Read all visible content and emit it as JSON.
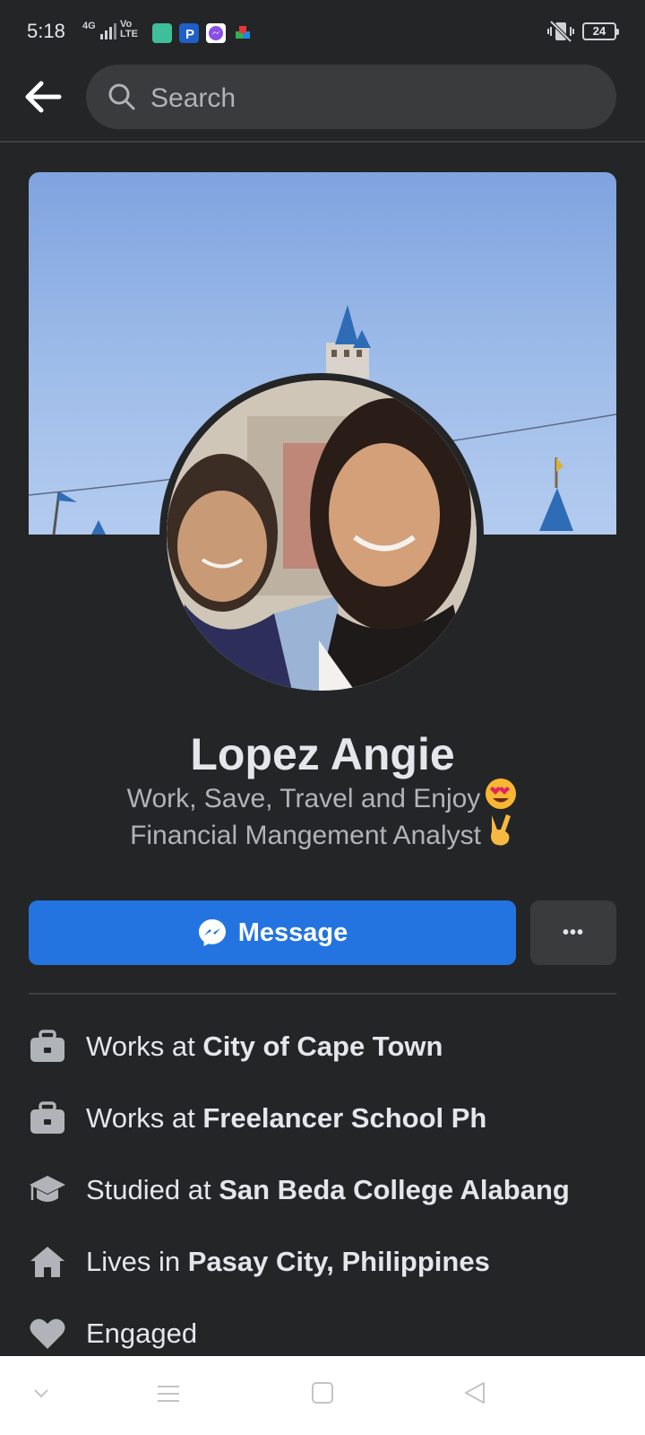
{
  "status_bar": {
    "time": "5:18",
    "network": "4G",
    "volte": "Vo LTE",
    "battery": "24",
    "icons": [
      "signal-icon",
      "calculator-app-icon",
      "paypal-app-icon",
      "messenger-app-icon",
      "puzzle-app-icon",
      "vibrate-icon",
      "battery-icon"
    ]
  },
  "header": {
    "search_placeholder": "Search"
  },
  "profile": {
    "name": "Lopez Angie",
    "bio_line1": "Work, Save, Travel and Enjoy",
    "bio_line2": "Financial Mangement Analyst",
    "bio_line1_emoji": "heart-eyes-emoji",
    "bio_line2_emoji": "victory-hand-emoji"
  },
  "actions": {
    "message_label": "Message",
    "more_label": "•••"
  },
  "intro": [
    {
      "icon": "briefcase-icon",
      "prefix": "Works at ",
      "value": "City of Cape Town"
    },
    {
      "icon": "briefcase-icon",
      "prefix": "Works at ",
      "value": "Freelancer School Ph"
    },
    {
      "icon": "graduation-cap-icon",
      "prefix": "Studied at ",
      "value": "San Beda College Alabang"
    },
    {
      "icon": "home-icon",
      "prefix": "Lives in ",
      "value": "Pasay City, Philippines"
    },
    {
      "icon": "heart-icon",
      "prefix": "Engaged",
      "value": ""
    }
  ],
  "colors": {
    "background": "#242526",
    "surface": "#3a3b3c",
    "accent": "#2374e1",
    "text_primary": "#e4e6eb",
    "text_secondary": "#b0b3b8"
  }
}
